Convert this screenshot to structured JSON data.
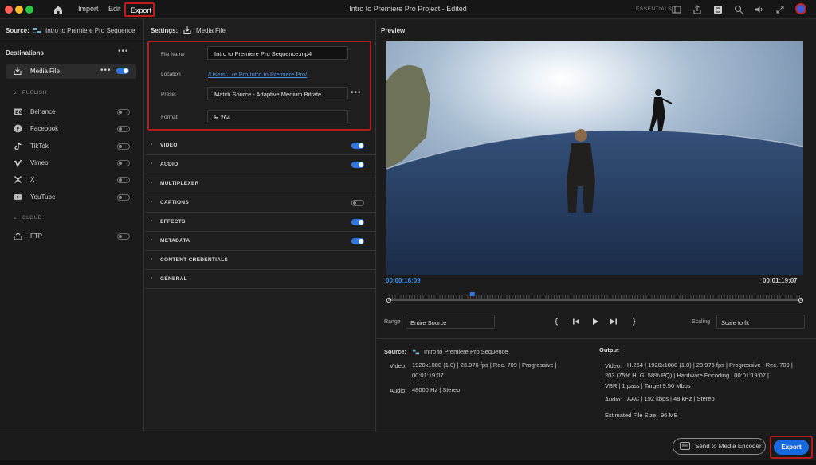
{
  "app": {
    "nav": {
      "import": "Import",
      "edit": "Edit",
      "export": "Export"
    },
    "title": "Intro to Premiere Pro Project - Edited",
    "workspace": "ESSENTIALS"
  },
  "source": {
    "label": "Source:",
    "name": "Intro to Premiere Pro Sequence"
  },
  "destinations": {
    "title": "Destinations",
    "more": "•••",
    "media_file": {
      "label": "Media File",
      "more": "•••",
      "enabled": true
    },
    "publish_header": "PUBLISH",
    "publish": [
      {
        "label": "Behance",
        "icon": "behance-icon",
        "enabled": false
      },
      {
        "label": "Facebook",
        "icon": "facebook-icon",
        "enabled": false
      },
      {
        "label": "TikTok",
        "icon": "tiktok-icon",
        "enabled": false
      },
      {
        "label": "Vimeo",
        "icon": "vimeo-icon",
        "enabled": false
      },
      {
        "label": "X",
        "icon": "x-icon",
        "enabled": false
      },
      {
        "label": "YouTube",
        "icon": "youtube-icon",
        "enabled": false
      }
    ],
    "cloud_header": "CLOUD",
    "cloud": [
      {
        "label": "FTP",
        "icon": "ftp-icon",
        "enabled": false
      }
    ]
  },
  "settings": {
    "title": "Settings:",
    "target": "Media File",
    "file_name_label": "File Name",
    "file_name": "Intro to Premiere Pro Sequence.mp4",
    "location_label": "Location",
    "location": "/Users/...re Pro/Intro to Premiere Pro/",
    "preset_label": "Preset",
    "preset": "Match Source - Adaptive Medium Bitrate",
    "preset_more": "•••",
    "format_label": "Format",
    "format": "H.264",
    "sections": [
      {
        "label": "VIDEO",
        "toggle": true
      },
      {
        "label": "AUDIO",
        "toggle": true
      },
      {
        "label": "MULTIPLEXER",
        "toggle": null
      },
      {
        "label": "CAPTIONS",
        "toggle": false
      },
      {
        "label": "EFFECTS",
        "toggle": true
      },
      {
        "label": "METADATA",
        "toggle": true
      },
      {
        "label": "CONTENT CREDENTIALS",
        "toggle": null
      },
      {
        "label": "GENERAL",
        "toggle": null
      }
    ]
  },
  "preview": {
    "title": "Preview",
    "current_time": "00:00:16:09",
    "duration": "00:01:19:07",
    "playhead_fraction": 0.206,
    "range_label": "Range",
    "range_value": "Entire Source",
    "scaling_label": "Scaling",
    "scaling_value": "Scale to fit"
  },
  "summary": {
    "source_label": "Source:",
    "source_name": "Intro to Premiere Pro Sequence",
    "source_video_label": "Video:",
    "source_video_line1": "1920x1080 (1.0)  |  23.976 fps  |  Rec. 709  |  Progressive  |",
    "source_video_line2": "00:01:19:07",
    "source_audio_label": "Audio:",
    "source_audio": "48000 Hz  |  Stereo",
    "output_label": "Output",
    "output_video_label": "Video:",
    "output_video_line1": "H.264  |  1920x1080 (1.0)  |  23.976 fps  |  Progressive  |  Rec. 709  |",
    "output_video_line2": "203 (75% HLG, 58% PQ)  |  Hardware Encoding  |  00:01:19:07  |",
    "output_video_line3": "VBR  |  1 pass  |  Target 9.50 Mbps",
    "output_audio_label": "Audio:",
    "output_audio": "AAC  |  192 kbps  |  48 kHz  |  Stereo",
    "file_size_label": "Estimated File Size:",
    "file_size": "96 MB"
  },
  "footer": {
    "send_to_encoder": "Send to Media Encoder",
    "export": "Export"
  },
  "colors": {
    "accent": "#2f78e4",
    "highlight": "#b71c1c",
    "timecode": "#3f8ce8"
  }
}
